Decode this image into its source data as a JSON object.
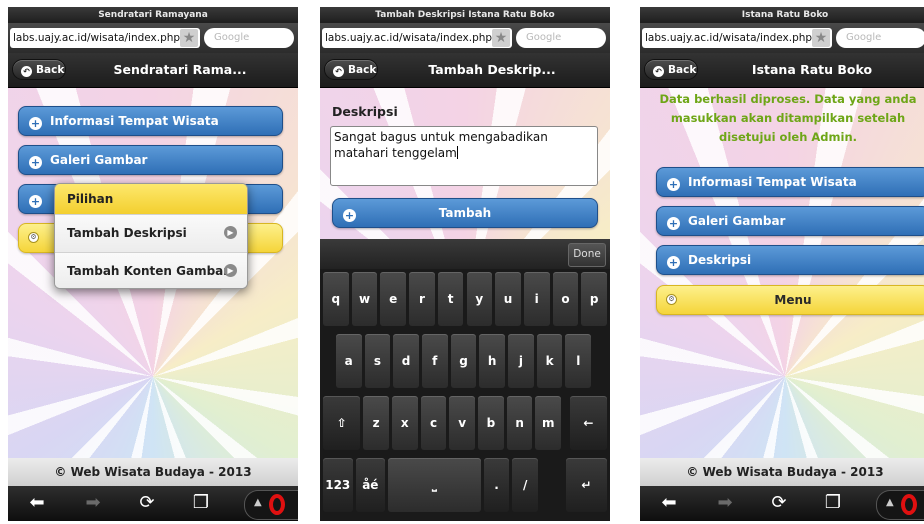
{
  "phone1": {
    "window_title": "Sendratari Ramayana",
    "url": "labs.uajy.ac.id/wisata/index.php",
    "search_placeholder": "Google",
    "back_label": "Back",
    "page_title": "Sendratari Rama...",
    "buttons": [
      "Informasi Tempat Wisata",
      "Galeri Gambar"
    ],
    "popup": {
      "title": "Pilihan",
      "items": [
        "Tambah Deskripsi",
        "Tambah Konten Gambar"
      ]
    },
    "footer": "© Web Wisata Budaya - 2013"
  },
  "phone2": {
    "window_title": "Tambah Deskripsi Istana Ratu Boko",
    "url": "labs.uajy.ac.id/wisata/index.php",
    "search_placeholder": "Google",
    "back_label": "Back",
    "page_title": "Tambah Deskrip...",
    "field_label": "Deskripsi",
    "field_value": "Sangat bagus untuk mengabadikan matahari tenggelam",
    "submit_label": "Tambah",
    "keyboard": {
      "done": "Done",
      "row1": [
        "q",
        "w",
        "e",
        "r",
        "t",
        "y",
        "u",
        "i",
        "o",
        "p"
      ],
      "row2": [
        "a",
        "s",
        "d",
        "f",
        "g",
        "h",
        "j",
        "k",
        "l"
      ],
      "row3": [
        "⇧",
        "z",
        "x",
        "c",
        "v",
        "b",
        "n",
        "m",
        "←"
      ],
      "row4": [
        "123",
        "åé",
        "⎵",
        ".",
        "/",
        "↵"
      ]
    }
  },
  "phone3": {
    "window_title": "Istana Ratu Boko",
    "url": "labs.uajy.ac.id/wisata/index.php",
    "search_placeholder": "Google",
    "back_label": "Back",
    "page_title": "Istana Ratu Boko",
    "message": "Data berhasil diproses. Data yang anda masukkan akan ditampilkan setelah disetujui oleh Admin.",
    "buttons": [
      "Informasi Tempat Wisata",
      "Galeri Gambar",
      "Deskripsi"
    ],
    "menu_label": "Menu",
    "footer": "© Web Wisata Budaya - 2013"
  },
  "colors": {
    "button_blue": "#2f6fb6",
    "menu_yellow": "#f5d53a",
    "success_green": "#6ea617",
    "opera_red": "#e01010"
  }
}
